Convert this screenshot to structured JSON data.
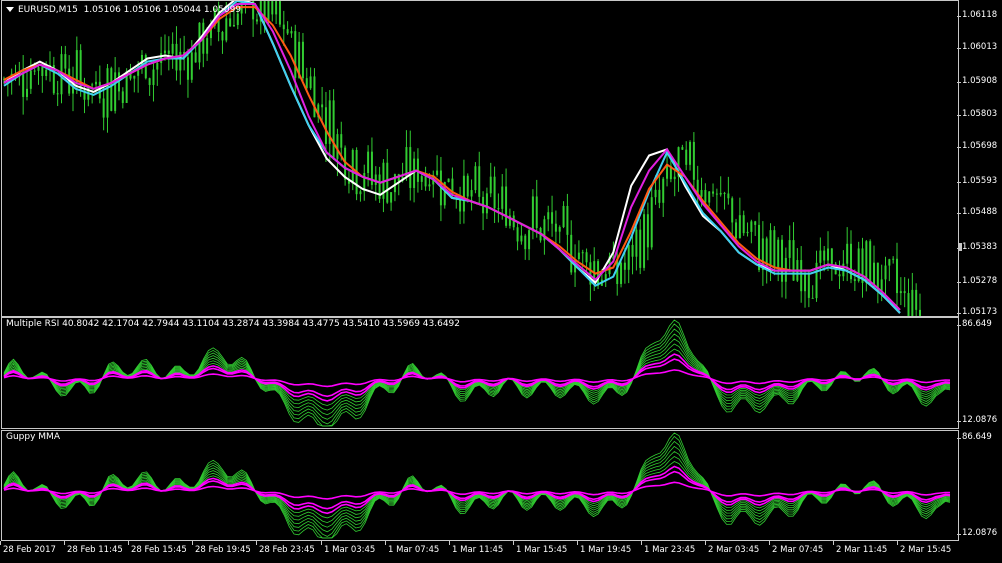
{
  "main": {
    "symbol_label": "EURUSD,M15",
    "ohlc": "1.05106 1.05106 1.05044 1.05099",
    "prices": [
      "1.06118",
      "1.06013",
      "1.05908",
      "1.05803",
      "1.05698",
      "1.05593",
      "1.05488",
      "1.05383",
      "1.05278",
      "1.05173"
    ]
  },
  "rsi_pane": {
    "title": "Multiple RSI 40.8042 42.1704 42.7944 43.1104 43.2874 43.3984 43.4775 43.5410 43.5969 43.6492",
    "max": "86.649",
    "min": "12.0876"
  },
  "guppy_pane": {
    "title": "Guppy MMA",
    "max": "86.649",
    "min": "12.0876"
  },
  "time_axis": [
    "28 Feb 2017",
    "28 Feb 11:45",
    "28 Feb 15:45",
    "28 Feb 19:45",
    "28 Feb 23:45",
    "1 Mar 03:45",
    "1 Mar 07:45",
    "1 Mar 11:45",
    "1 Mar 15:45",
    "1 Mar 19:45",
    "1 Mar 23:45",
    "2 Mar 03:45",
    "2 Mar 07:45",
    "2 Mar 11:45",
    "2 Mar 15:45"
  ],
  "colors": {
    "background": "#000000",
    "bars": "#32cd32",
    "ma_white": "#ffffff",
    "ma_cyan": "#40d0f0",
    "ma_orange": "#ff5a14",
    "ma_magenta": "#e020e0",
    "oscillator_lines": "#32cd32",
    "oscillator_core": "#ff00ff"
  },
  "chart_data": {
    "type": "line",
    "symbol": "EURUSD",
    "timeframe": "M15",
    "ylim": [
      1.0512,
      1.0616
    ],
    "series": [
      {
        "color": "#ffffff",
        "values": [
          1.0589,
          1.0593,
          1.0596,
          1.0593,
          1.0588,
          1.0586,
          1.0589,
          1.0593,
          1.0597,
          1.0598,
          1.0597,
          1.0604,
          1.0612,
          1.0617,
          1.0615,
          1.0602,
          1.0588,
          1.0575,
          1.0564,
          1.0558,
          1.0554,
          1.0552,
          1.0556,
          1.056,
          1.0557,
          1.0551,
          1.055,
          1.0548,
          1.0545,
          1.0542,
          1.0539,
          1.0534,
          1.0528,
          1.0523,
          1.0533,
          1.0555,
          1.0565,
          1.0567,
          1.0555,
          1.0545,
          1.054,
          1.0533,
          1.0529,
          1.0527,
          1.0527,
          1.0527,
          1.0529,
          1.0527,
          1.0524,
          1.0519,
          1.0513
        ]
      },
      {
        "color": "#40d0f0",
        "values": [
          1.0588,
          1.0592,
          1.0595,
          1.0592,
          1.0587,
          1.0585,
          1.0588,
          1.0592,
          1.0596,
          1.0597,
          1.0597,
          1.0603,
          1.0611,
          1.0616,
          1.0615,
          1.0602,
          1.0588,
          1.0575,
          1.0566,
          1.0561,
          1.0558,
          1.0556,
          1.0558,
          1.056,
          1.0557,
          1.0551,
          1.055,
          1.0548,
          1.0545,
          1.0542,
          1.0539,
          1.0534,
          1.0528,
          1.0522,
          1.0525,
          1.0538,
          1.0553,
          1.0566,
          1.0556,
          1.0546,
          1.054,
          1.0533,
          1.0529,
          1.0526,
          1.0526,
          1.0526,
          1.0528,
          1.0527,
          1.0524,
          1.0519,
          1.0513
        ]
      },
      {
        "color": "#ff5a14",
        "values": [
          1.059,
          1.0593,
          1.0595,
          1.0593,
          1.059,
          1.0587,
          1.0589,
          1.0592,
          1.0595,
          1.0597,
          1.0598,
          1.0603,
          1.061,
          1.0614,
          1.0614,
          1.0608,
          1.0598,
          1.0585,
          1.0573,
          1.0563,
          1.0558,
          1.0556,
          1.0558,
          1.056,
          1.0558,
          1.0553,
          1.055,
          1.0548,
          1.0545,
          1.0542,
          1.0539,
          1.0535,
          1.053,
          1.0526,
          1.0528,
          1.054,
          1.0554,
          1.0562,
          1.0558,
          1.055,
          1.0543,
          1.0536,
          1.0531,
          1.0528,
          1.0527,
          1.0527,
          1.0529,
          1.0528,
          1.0525,
          1.052,
          1.0514
        ]
      },
      {
        "color": "#e020e0",
        "values": [
          1.0589,
          1.0592,
          1.0595,
          1.0593,
          1.0589,
          1.0587,
          1.0589,
          1.0592,
          1.0595,
          1.0597,
          1.0598,
          1.0603,
          1.0611,
          1.0615,
          1.0615,
          1.0606,
          1.0593,
          1.0578,
          1.0566,
          1.0561,
          1.0558,
          1.0556,
          1.0558,
          1.056,
          1.0557,
          1.0552,
          1.055,
          1.0548,
          1.0545,
          1.0542,
          1.0539,
          1.0534,
          1.0529,
          1.0524,
          1.053,
          1.0548,
          1.056,
          1.0567,
          1.0558,
          1.0549,
          1.0542,
          1.0535,
          1.053,
          1.0527,
          1.0527,
          1.0527,
          1.0529,
          1.0528,
          1.0525,
          1.052,
          1.0514
        ]
      }
    ]
  }
}
